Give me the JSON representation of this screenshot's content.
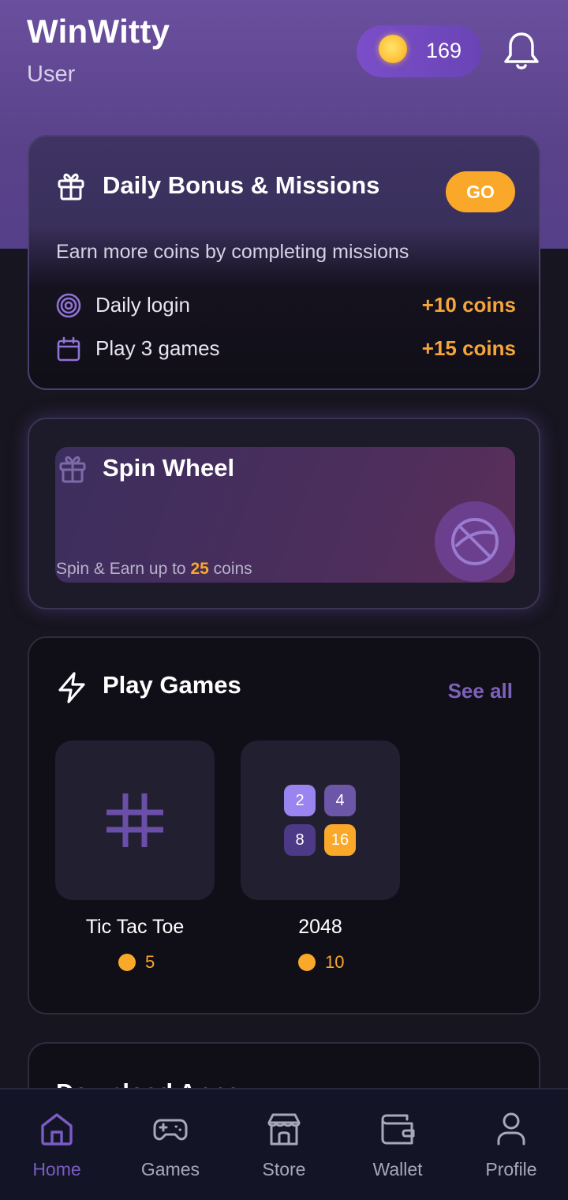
{
  "header": {
    "app_title": "WinWitty",
    "subtitle": "User",
    "coin_balance": "169",
    "coin_icon": "coin-icon",
    "notification_icon": "bell-icon"
  },
  "daily": {
    "icon": "gift-icon",
    "title": "Daily Bonus & Missions",
    "go_label": "GO",
    "description": "Earn more coins by completing missions",
    "missions": [
      {
        "icon": "target-icon",
        "label": "Daily login",
        "reward": "+10 coins"
      },
      {
        "icon": "calendar-icon",
        "label": "Play 3 games",
        "reward": "+15 coins"
      }
    ]
  },
  "spin": {
    "icon": "gift-icon",
    "title": "Spin Wheel",
    "sub_prefix": "Spin & Earn up to ",
    "sub_amount": "25",
    "sub_suffix": " coins"
  },
  "games": {
    "icon": "lightning-icon",
    "title": "Play Games",
    "see_all": "See all",
    "items": [
      {
        "name": "Tic Tac Toe",
        "cost": "5",
        "icon": "hash-grid-icon"
      },
      {
        "name": "2048",
        "cost": "10",
        "tiles": [
          "2",
          "4",
          "8",
          "16"
        ]
      }
    ]
  },
  "download": {
    "title": "Download Apps"
  },
  "nav": {
    "items": [
      {
        "label": "Home",
        "icon": "home-icon",
        "active": true
      },
      {
        "label": "Games",
        "icon": "gamepad-icon"
      },
      {
        "label": "Store",
        "icon": "store-icon"
      },
      {
        "label": "Wallet",
        "icon": "wallet-icon"
      },
      {
        "label": "Profile",
        "icon": "user-icon"
      }
    ]
  },
  "colors": {
    "accent_orange": "#f9a829",
    "accent_purple": "#7a5cc4",
    "background": "#17151f"
  }
}
